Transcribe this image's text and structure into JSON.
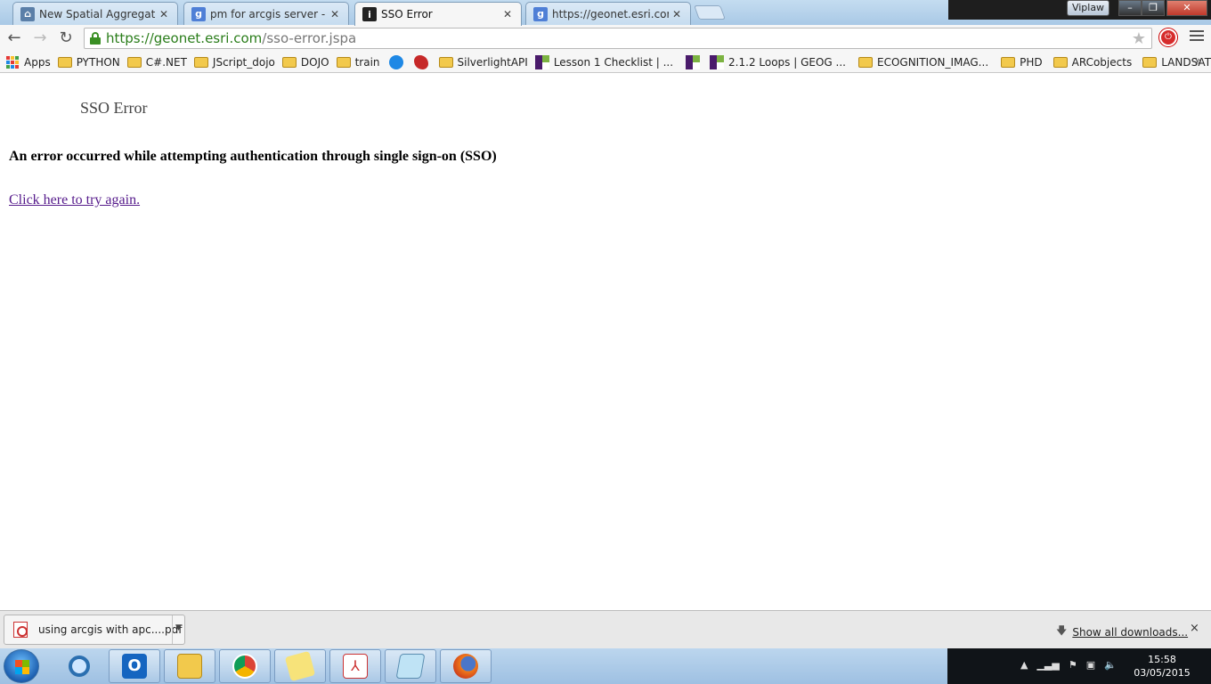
{
  "browser": {
    "tabs": [
      {
        "label": "New Spatial Aggregation",
        "favicon": "arcgis-icon",
        "active": false
      },
      {
        "label": "pm for arcgis server - Goo",
        "favicon": "google-icon",
        "active": false
      },
      {
        "label": "SSO Error",
        "favicon": "info-icon",
        "active": true
      },
      {
        "label": "https://geonet.esri.com/ss",
        "favicon": "google-icon",
        "active": false
      }
    ],
    "user_badge": "Viplaw",
    "address": {
      "scheme_host": "https://geonet.esri.com",
      "path": "/sso-error.jspa"
    },
    "bookmarks": [
      {
        "label": "Apps",
        "icon": "apps-grid-icon"
      },
      {
        "label": "PYTHON",
        "icon": "folder-icon"
      },
      {
        "label": "C#.NET",
        "icon": "folder-icon"
      },
      {
        "label": "JScript_dojo",
        "icon": "folder-icon"
      },
      {
        "label": "DOJO",
        "icon": "folder-icon"
      },
      {
        "label": "train",
        "icon": "folder-icon"
      },
      {
        "label": "",
        "icon": "blue-circle-icon"
      },
      {
        "label": "",
        "icon": "red-logo-icon"
      },
      {
        "label": "SilverlightAPI",
        "icon": "folder-icon"
      },
      {
        "label": "Lesson 1 Checklist | ...",
        "icon": "psu-icon"
      },
      {
        "label": "",
        "icon": "psu-icon"
      },
      {
        "label": "2.1.2 Loops | GEOG ...",
        "icon": "psu-icon"
      },
      {
        "label": "ECOGNITION_IMAG...",
        "icon": "folder-icon"
      },
      {
        "label": "PHD",
        "icon": "folder-icon"
      },
      {
        "label": "ARCobjects",
        "icon": "folder-icon"
      },
      {
        "label": "LANDSAT",
        "icon": "folder-icon"
      }
    ],
    "bookmarks_more": "»"
  },
  "page": {
    "title": "SSO Error",
    "heading": "An error occurred while attempting authentication through single sign-on (SSO)",
    "link": "Click here to try again."
  },
  "downloads": {
    "item": "using arcgis with apc....pdf",
    "show_all": "Show all downloads...",
    "close": "×"
  },
  "taskbar": {
    "time": "15:58",
    "date": "03/05/2015"
  }
}
